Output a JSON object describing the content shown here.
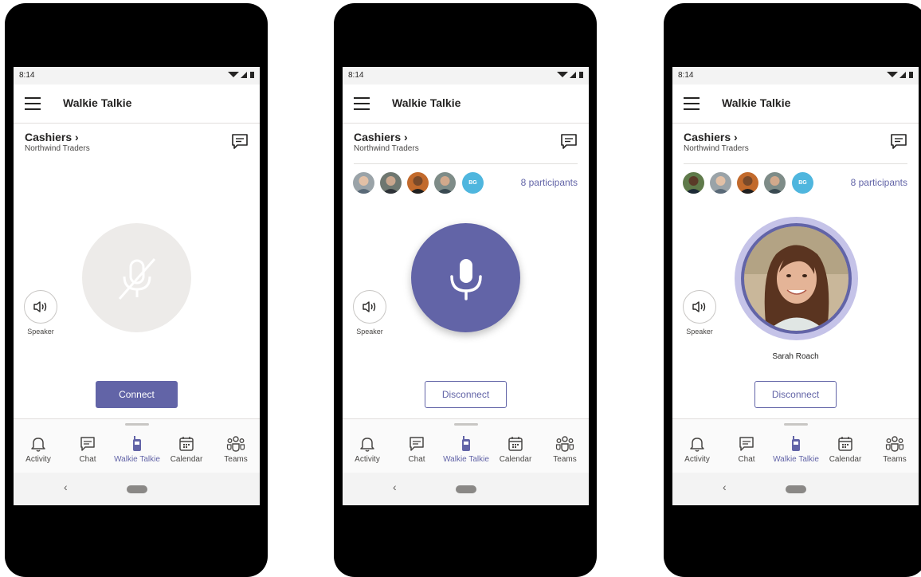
{
  "status_bar": {
    "time": "8:14"
  },
  "app": {
    "title": "Walkie Talkie"
  },
  "channel": {
    "name": "Cashiers",
    "chevron": "›",
    "team": "Northwind Traders"
  },
  "participants": {
    "label": "8 participants",
    "initials": "BG"
  },
  "speaker_label": "Speaker",
  "buttons": {
    "connect": "Connect",
    "disconnect": "Disconnect"
  },
  "speaking_user": "Sarah Roach",
  "tabs": [
    {
      "label": "Activity",
      "icon": "bell-icon"
    },
    {
      "label": "Chat",
      "icon": "chat-icon"
    },
    {
      "label": "Walkie Talkie",
      "icon": "walkie-talkie-icon"
    },
    {
      "label": "Calendar",
      "icon": "calendar-icon"
    },
    {
      "label": "Teams",
      "icon": "teams-icon"
    }
  ],
  "nav": {
    "back": "‹"
  },
  "colors": {
    "accent": "#6264a7",
    "muted": "#edebe9",
    "ring": "#c5c3e8",
    "avatar_initials": "#4fb6de"
  }
}
